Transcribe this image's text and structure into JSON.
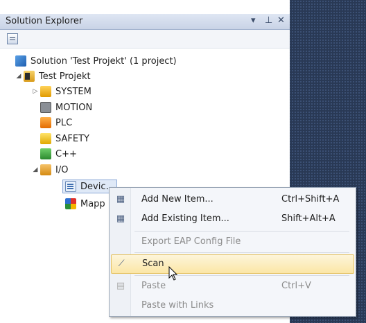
{
  "window": {
    "title": "Solution Explorer",
    "dropdown_glyph": "▾",
    "pin_glyph": "⊥",
    "close_glyph": "✕"
  },
  "toolbar": {
    "icons": [
      "properties-icon"
    ]
  },
  "tree": {
    "solution": "Solution 'Test Projekt' (1 project)",
    "project": "Test Projekt",
    "system": "SYSTEM",
    "motion": "MOTION",
    "plc": "PLC",
    "safety": "SAFETY",
    "cpp": "C++",
    "io": "I/O",
    "devices": "Devic…",
    "mappings": "Mapp",
    "expanded_arrow": "◢",
    "collapsed_arrow": "▷"
  },
  "menu": {
    "add_new_item": {
      "label": "Add New Item...",
      "shortcut": "Ctrl+Shift+A"
    },
    "add_existing_item": {
      "label": "Add Existing Item...",
      "shortcut": "Shift+Alt+A"
    },
    "export_eap": {
      "label": "Export EAP Config File"
    },
    "scan": {
      "label": "Scan"
    },
    "paste": {
      "label": "Paste",
      "shortcut": "Ctrl+V"
    },
    "paste_links": {
      "label": "Paste with Links"
    }
  },
  "colors": {
    "background": "#293955",
    "menu_highlight": "#fbe6a6"
  }
}
